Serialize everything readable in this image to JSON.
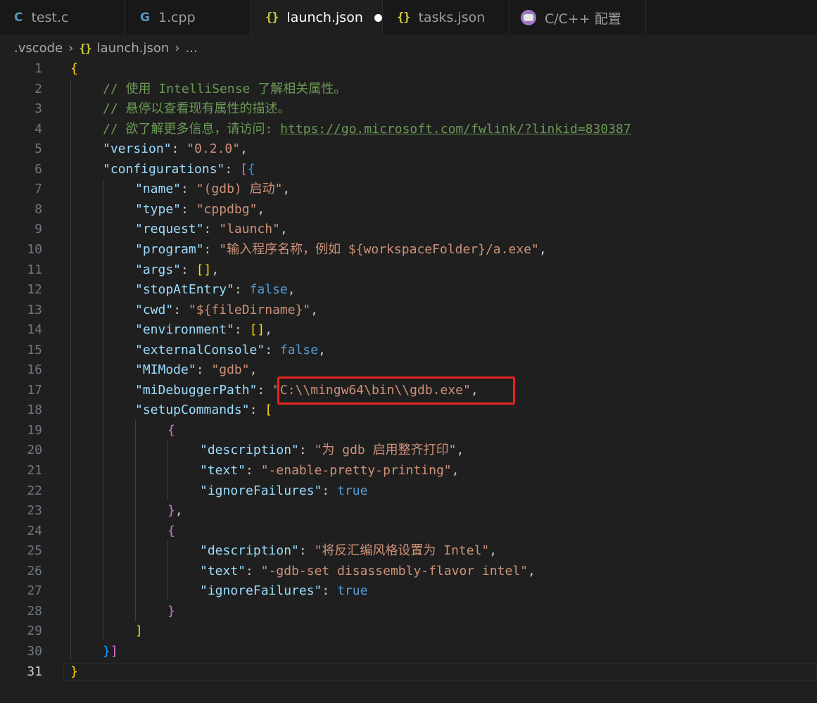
{
  "tabs": [
    {
      "label": "test.c",
      "icon": "c-file-icon"
    },
    {
      "label": "1.cpp",
      "icon": "cpp-file-icon"
    },
    {
      "label": "launch.json",
      "icon": "json-file-icon",
      "active": true,
      "dirty": true
    },
    {
      "label": "tasks.json",
      "icon": "json-file-icon"
    },
    {
      "label": "C/C++ 配置",
      "icon": "cpp-config-icon"
    }
  ],
  "breadcrumb": {
    "folder": ".vscode",
    "file": "launch.json",
    "more": "..."
  },
  "editor": {
    "line_numbers": [
      "1",
      "2",
      "3",
      "4",
      "5",
      "6",
      "7",
      "8",
      "9",
      "10",
      "11",
      "12",
      "13",
      "14",
      "15",
      "16",
      "17",
      "18",
      "19",
      "20",
      "21",
      "22",
      "23",
      "24",
      "25",
      "26",
      "27",
      "28",
      "29",
      "30",
      "31"
    ],
    "current_line": "31",
    "text": {
      "comment1": "// 使用 IntelliSense 了解相关属性。",
      "comment2": "// 悬停以查看现有属性的描述。",
      "comment3": "// 欲了解更多信息，请访问: ",
      "url": "https://go.microsoft.com/fwlink/?linkid=830387",
      "version_key": "\"version\"",
      "version_val": "\"0.2.0\"",
      "configurations_key": "\"configurations\"",
      "name_key": "\"name\"",
      "name_val": "\"(gdb) 启动\"",
      "type_key": "\"type\"",
      "type_val": "\"cppdbg\"",
      "request_key": "\"request\"",
      "request_val": "\"launch\"",
      "program_key": "\"program\"",
      "program_val": "\"输入程序名称，例如 ${workspaceFolder}/a.exe\"",
      "args_key": "\"args\"",
      "stopAtEntry_key": "\"stopAtEntry\"",
      "false": "false",
      "true": "true",
      "cwd_key": "\"cwd\"",
      "cwd_val": "\"${fileDirname}\"",
      "environment_key": "\"environment\"",
      "externalConsole_key": "\"externalConsole\"",
      "MIMode_key": "\"MIMode\"",
      "MIMode_val": "\"gdb\"",
      "miDebuggerPath_key": "\"miDebuggerPath\"",
      "miDebuggerPath_val": "\"C:\\\\mingw64\\bin\\\\gdb.exe\"",
      "setupCommands_key": "\"setupCommands\"",
      "description_key": "\"description\"",
      "text_key": "\"text\"",
      "ignoreFailures_key": "\"ignoreFailures\"",
      "desc1_val": "\"为 gdb 启用整齐打印\"",
      "text1_val": "\"-enable-pretty-printing\"",
      "desc2_val": "\"将反汇编风格设置为 Intel\"",
      "text2_val": "\"-gdb-set disassembly-flavor intel\""
    }
  },
  "colors": {
    "background": "#1f1f1f",
    "key": "#9cdcfe",
    "string": "#ce9178",
    "boolean": "#569cd6",
    "comment": "#6a9955",
    "highlight_box": "#e5261f"
  }
}
